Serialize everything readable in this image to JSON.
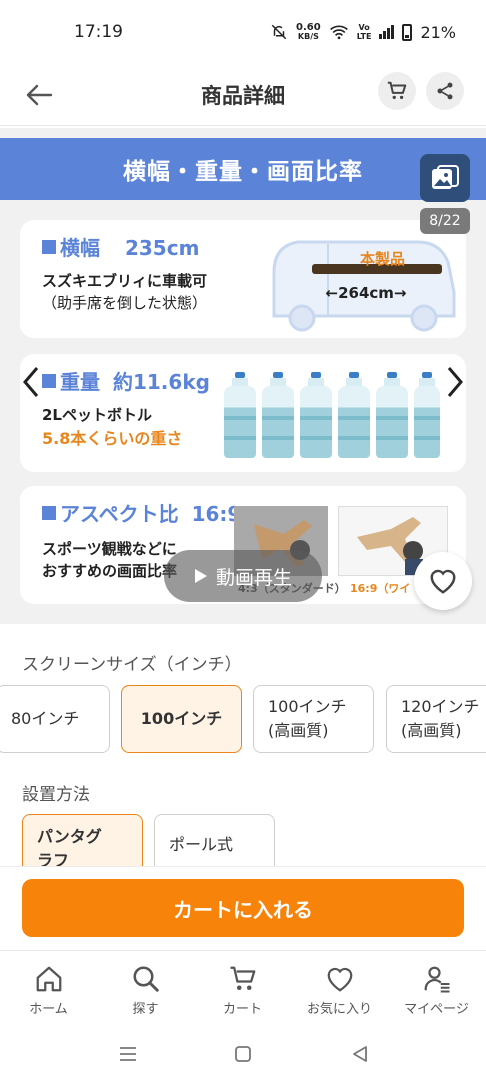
{
  "status_bar": {
    "time": "17:19",
    "speed_value": "0.60",
    "speed_unit": "KB/S",
    "network_tag_top": "Vo",
    "network_tag_bottom": "LTE",
    "battery": "21%"
  },
  "header": {
    "title": "商品詳細"
  },
  "gallery": {
    "banner": "横幅・重量・画面比率",
    "counter": "8/22",
    "play_label": "動画再生",
    "cards": [
      {
        "title_label": "横幅",
        "title_value": "235cm",
        "lines": [
          "スズキエブリィに車載可",
          "（助手席を倒した状態）"
        ],
        "product_tag": "本製品",
        "dimension": "264cm"
      },
      {
        "title_label": "重量",
        "title_value": "約11.6kg",
        "lines": [
          "2Lペットボトル"
        ],
        "highlight": "5.8本くらいの重さ"
      },
      {
        "title_label": "アスペクト比",
        "title_value": "16:9",
        "lines": [
          "スポーツ観戦などに",
          "おすすめの画面比率"
        ],
        "caption_left": "4:3（スタンダード）",
        "caption_right": "16:9（ワイ"
      }
    ]
  },
  "screen_size": {
    "label": "スクリーンサイズ（インチ）",
    "options": [
      {
        "line1": "80インチ",
        "line2": ""
      },
      {
        "line1": "100インチ",
        "line2": ""
      },
      {
        "line1": "100インチ",
        "line2": "(高画質)"
      },
      {
        "line1": "120インチ",
        "line2": "(高画質)"
      }
    ],
    "selected_index": 1
  },
  "install": {
    "label": "設置方法",
    "options": [
      {
        "line1": "パンタグ",
        "line2": "ラフ"
      },
      {
        "line1": "ポール式",
        "line2": ""
      }
    ],
    "selected_index": 0
  },
  "cta": {
    "label": "カートに入れる",
    "color": "#f7830b"
  },
  "bottom_nav": {
    "items": [
      {
        "label": "ホーム",
        "icon": "home-icon"
      },
      {
        "label": "探す",
        "icon": "search-icon"
      },
      {
        "label": "カート",
        "icon": "cart-icon"
      },
      {
        "label": "お気に入り",
        "icon": "heart-icon"
      },
      {
        "label": "マイページ",
        "icon": "person-icon"
      }
    ]
  },
  "colors": {
    "accent": "#f7830b",
    "banner_blue": "#5b83d8",
    "highlight_orange": "#e8861d"
  }
}
